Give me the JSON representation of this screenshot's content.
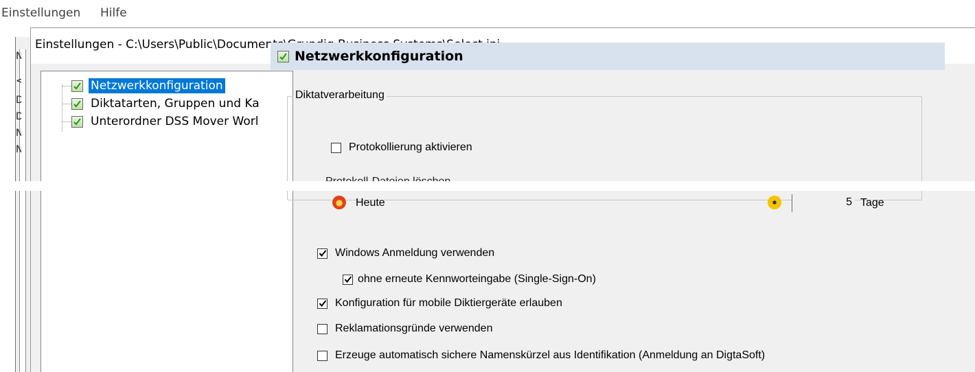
{
  "menubar": {
    "items": [
      "Einstellungen",
      "Hilfe"
    ]
  },
  "background_window": {
    "letters": [
      "N",
      "<",
      "D",
      "D",
      "N",
      "N"
    ]
  },
  "dialog": {
    "title": "Einstellungen - C:\\Users\\Public\\Documents\\Grundig Business Systems\\Select.ini"
  },
  "tree": {
    "items": [
      {
        "label": "Netzwerkkonfiguration",
        "selected": true
      },
      {
        "label": "Diktatarten, Gruppen und Ka",
        "selected": false
      },
      {
        "label": "Unterordner DSS Mover Worl",
        "selected": false
      }
    ]
  },
  "panel": {
    "title": "Netzwerkkonfiguration",
    "group": {
      "legend": "Diktatverarbeitung",
      "logging_label": "Protokollierung aktivieren",
      "logging_checked": false,
      "delete_files_label_partial": "Protokoll-Dateien löschen",
      "today_label": "Heute",
      "days_value": "5",
      "days_unit": "Tage"
    },
    "options": [
      {
        "label": "Windows Anmeldung verwenden",
        "checked": true
      },
      {
        "label": "ohne erneute Kennworteingabe (Single-Sign-On)",
        "checked": true
      },
      {
        "label": "Konfiguration für mobile Diktiergeräte erlauben",
        "checked": true
      },
      {
        "label": "Reklamationsgründe verwenden",
        "checked": false
      },
      {
        "label": "Erzeuge automatisch sichere Namenskürzel aus Identifikation (Anmeldung an DigtaSoft)",
        "checked": false
      }
    ]
  },
  "colors": {
    "selection": "#0078d7",
    "header_bg": "#d8e2ee",
    "dialog_bg": "#f0f0f0"
  }
}
